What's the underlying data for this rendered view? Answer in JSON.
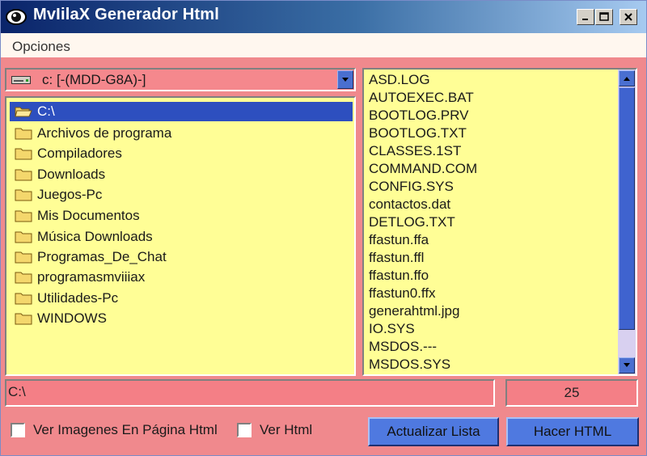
{
  "window": {
    "title": "MvIilaX Generador Html",
    "icon": "eye-icon",
    "controls": [
      "minimize-icon",
      "maximize-icon",
      "close-icon"
    ]
  },
  "menu": {
    "items": [
      "Opciones"
    ]
  },
  "drive": {
    "label": "c: [-(MDD-G8A)-]",
    "icon": "drive-icon"
  },
  "directories": {
    "current": "C:\\",
    "items": [
      "Archivos de programa",
      "Compiladores",
      "Downloads",
      "Juegos-Pc",
      "Mis Documentos",
      "Música Downloads",
      "Programas_De_Chat",
      "programasmviiiax",
      "Utilidades-Pc",
      "WINDOWS"
    ]
  },
  "files": {
    "items": [
      "ASD.LOG",
      "AUTOEXEC.BAT",
      "BOOTLOG.PRV",
      "BOOTLOG.TXT",
      "CLASSES.1ST",
      "COMMAND.COM",
      "CONFIG.SYS",
      "contactos.dat",
      "DETLOG.TXT",
      "ffastun.ffa",
      "ffastun.ffl",
      "ffastun.ffo",
      "ffastun0.ffx",
      "generahtml.jpg",
      "IO.SYS",
      "MSDOS.---",
      "MSDOS.SYS"
    ]
  },
  "status": {
    "path": "C:\\",
    "count": "25"
  },
  "options": {
    "ver_imagenes_label": "Ver Imagenes En Página Html",
    "ver_html_label": "Ver Html",
    "ver_imagenes_checked": false,
    "ver_html_checked": false
  },
  "buttons": {
    "actualizar": "Actualizar Lista",
    "hacer": "Hacer HTML"
  },
  "colors": {
    "background": "#f0898d",
    "panel": "#fffe96",
    "selection": "#2d4fbf",
    "button": "#4f79e0"
  }
}
